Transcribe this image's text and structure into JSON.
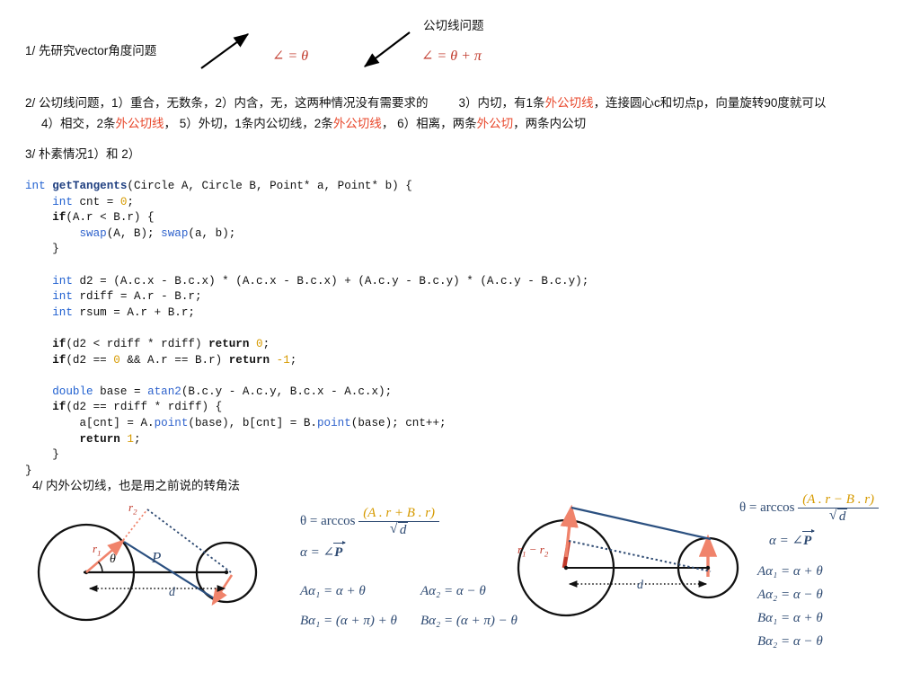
{
  "page": {
    "title_cn": "公切线问题",
    "colors": {
      "red": "#e8472b",
      "math_blue": "#2e4a72",
      "code_blue": "#2060d0",
      "code_number": "#d69a00",
      "salmon": "#f0836b",
      "dark_red": "#c0392b"
    }
  },
  "section1": {
    "heading": "1/  先研究vector角度问题",
    "arrow_up_label": "∠ = θ",
    "arrow_down_label": "∠ = θ + π"
  },
  "section2": {
    "line1_a": "2/  公切线问题，1）重合，无数条，2）内含，无，这两种情况没有需要求的",
    "line1_b_pre": "3）内切，有1条",
    "line1_b_red": "外公切线",
    "line1_b_post": "，连接圆心c和切点p，向量旋转90度就可以",
    "line2_seg1": "4）相交，2条",
    "line2_red1": "外公切线",
    "line2_seg2": "，  5）外切，1条内公切线，2条",
    "line2_red2": "外公切线",
    "line2_seg3": "，  6）相离，两条",
    "line2_red3": "外公切",
    "line2_seg4": "，两条内公切"
  },
  "section3": {
    "heading": "3/  朴素情况1）和 2）",
    "code_lines": [
      "int getTangents(Circle A, Circle B, Point* a, Point* b) {",
      "    int cnt = 0;",
      "    if(A.r < B.r) {",
      "        swap(A, B); swap(a, b);",
      "    }",
      "",
      "    int d2 = (A.c.x - B.c.x) * (A.c.x - B.c.x) + (A.c.y - B.c.y) * (A.c.y - B.c.y);",
      "    int rdiff = A.r - B.r;",
      "    int rsum = A.r + B.r;",
      "",
      "    if(d2 < rdiff * rdiff) return 0;",
      "    if(d2 == 0 && A.r == B.r) return -1;",
      "",
      "    double base = atan2(B.c.y - A.c.y, B.c.x - A.c.x);",
      "    if(d2 == rdiff * rdiff) {",
      "        a[cnt] = A.point(base), b[cnt] = B.point(base); cnt++;",
      "        return 1;",
      "    }",
      "}"
    ]
  },
  "section4": {
    "heading": "4/  内外公切线，也是用之前说的转角法",
    "left_diagram": {
      "label_r1": "r",
      "label_r1_sub": "1",
      "label_r2": "r",
      "label_r2_sub": "2",
      "label_theta": "θ",
      "label_P": "P",
      "label_d": "d"
    },
    "left_formulas": {
      "theta_lhs": "θ = arccos",
      "theta_num": "(A . r + B . r)",
      "theta_den": "d",
      "alpha": "α = ∠",
      "alpha_vec": "P",
      "rows": [
        {
          "left": "Aα₁ = α + θ",
          "right": "Aα₂ = α − θ"
        },
        {
          "left": "Bα₁ = (α + π) + θ",
          "right": "Bα₂ = (α + π) − θ"
        }
      ]
    },
    "right_diagram": {
      "label_rdiff": "r₁ − r₂",
      "label_d": "d"
    },
    "right_formulas": {
      "theta_lhs": "θ = arccos",
      "theta_num": "(A . r − B . r)",
      "theta_den": "d",
      "alpha": "α = ∠",
      "alpha_vec": "P",
      "rows": [
        "Aα₁ = α + θ",
        "Aα₂ = α − θ",
        "Bα₁ = α + θ",
        "Bα₂ = α − θ"
      ]
    }
  }
}
